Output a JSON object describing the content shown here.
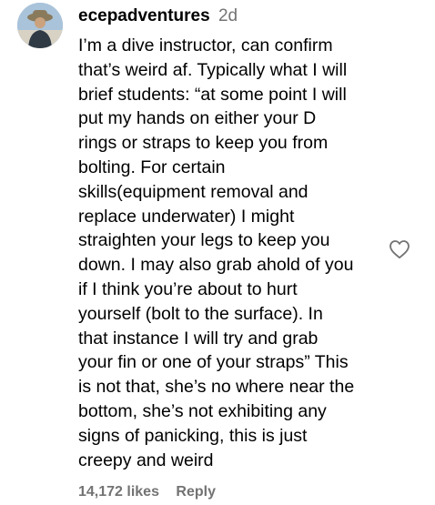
{
  "comment": {
    "username": "ecepadventures",
    "timestamp": "2d",
    "text": "I’m a dive instructor, can confirm\nthat’s weird af. Typically what I will\nbrief students: “at some point I will\nput my hands on either your D\nrings or straps to keep you from\nbolting. For certain\nskills(equipment removal and\nreplace underwater) I might\nstraighten your legs to keep you\ndown. I may also grab ahold of you\nif I think you’re about to hurt\nyourself (bolt to the surface). In\nthat instance I will try and grab\nyour fin or one of your straps” This\nis not that, she’s no where near the\nbottom, she’s not exhibiting any\nsigns of panicking, this is just\ncreepy and weird",
    "likes": "14,172 likes",
    "reply_label": "Reply"
  },
  "icons": {
    "like": "heart-outline-icon",
    "avatar": "user-avatar"
  },
  "colors": {
    "text": "#000000",
    "secondary_text": "#737373",
    "background": "#ffffff"
  }
}
